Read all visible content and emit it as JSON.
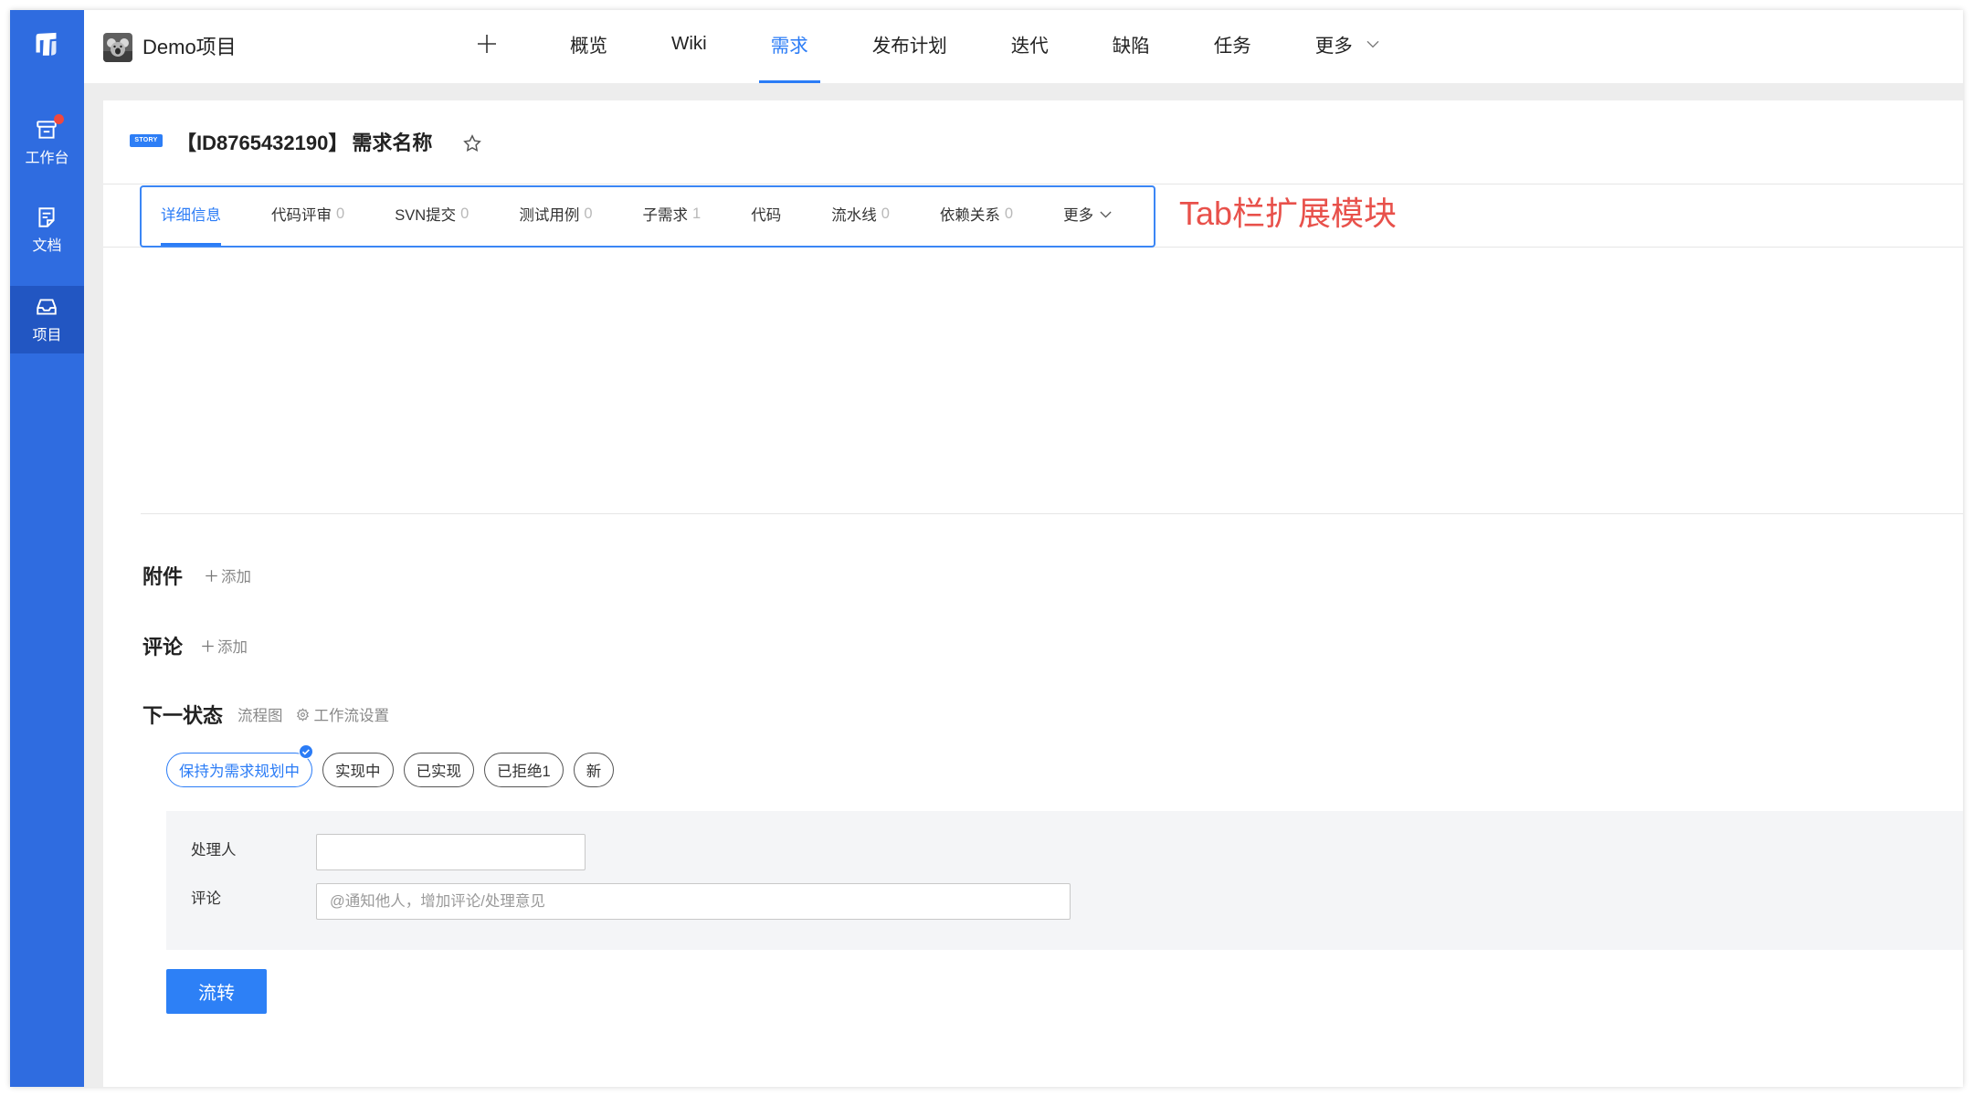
{
  "colors": {
    "sidebar": "#2f6ce0",
    "sidebar_active": "#2256c2",
    "primary": "#2b7cf6",
    "annotation": "#e8514b",
    "notification_dot": "#f0483e"
  },
  "sidebar": {
    "logo_icon": "app-logo-icon",
    "items": [
      {
        "label": "工作台",
        "icon": "workbench-icon",
        "has_notification": true
      },
      {
        "label": "文档",
        "icon": "document-icon"
      },
      {
        "label": "项目",
        "icon": "project-icon",
        "active": true
      }
    ]
  },
  "header": {
    "project_name": "Demo项目",
    "add_icon": "plus-icon",
    "nav": [
      {
        "label": "概览"
      },
      {
        "label": "Wiki"
      },
      {
        "label": "需求",
        "active": true
      },
      {
        "label": "发布计划"
      },
      {
        "label": "迭代"
      },
      {
        "label": "缺陷"
      },
      {
        "label": "任务"
      },
      {
        "label": "更多",
        "icon": "chevron-down-icon"
      }
    ]
  },
  "story": {
    "type_badge": "STORY",
    "id": "【ID8765432190】",
    "title": "需求名称",
    "favorite_icon": "star-outline-icon"
  },
  "tabs": [
    {
      "label": "详细信息",
      "active": true
    },
    {
      "label": "代码评审",
      "count": "0"
    },
    {
      "label": "SVN提交",
      "count": "0"
    },
    {
      "label": "测试用例",
      "count": "0"
    },
    {
      "label": "子需求",
      "count": "1"
    },
    {
      "label": "代码"
    },
    {
      "label": "流水线",
      "count": "0"
    },
    {
      "label": "依赖关系",
      "count": "0"
    },
    {
      "label": "更多",
      "icon": "chevron-down-icon"
    }
  ],
  "annotation": "Tab栏扩展模块",
  "attachments": {
    "heading": "附件",
    "add_label": "添加"
  },
  "comments": {
    "heading": "评论",
    "add_label": "添加"
  },
  "next_state": {
    "heading": "下一状态",
    "flowchart_link": "流程图",
    "workflow_settings_link": "工作流设置",
    "options": [
      {
        "label": "保持为需求规划中",
        "selected": true
      },
      {
        "label": "实现中"
      },
      {
        "label": "已实现"
      },
      {
        "label": "已拒绝1"
      },
      {
        "label": "新"
      }
    ]
  },
  "form": {
    "assignee_label": "处理人",
    "assignee_value": "",
    "comment_label": "评论",
    "comment_placeholder": "@通知他人，增加评论/处理意见"
  },
  "submit_label": "流转"
}
